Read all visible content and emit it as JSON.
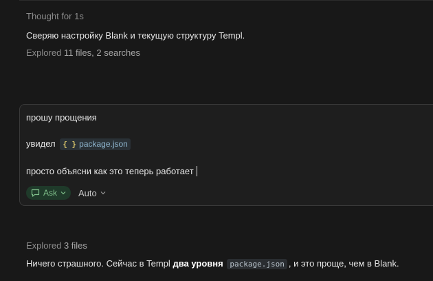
{
  "thought": {
    "text": "Thought for 1s"
  },
  "intro": {
    "text": "Сверяю настройку Blank и текущую структуру Templ."
  },
  "explored_top": {
    "label": "Explored",
    "detail": "11 files, 2 searches"
  },
  "composer": {
    "line1": "прошу прощения",
    "line2_prefix": "увидел",
    "file_chip": {
      "icon": "braces-icon",
      "name": "package.json"
    },
    "line3": "просто объясни как это теперь работает",
    "mode_button": {
      "icon": "chat-icon",
      "label": "Ask"
    },
    "model_button": {
      "label": "Auto"
    }
  },
  "explored_bottom": {
    "label": "Explored",
    "detail": "3 files"
  },
  "answer": {
    "part1": "Ничего страшного. Сейчас в Templ",
    "bold": "два уровня",
    "code": "package.json",
    "part2": ", и это проще, чем в Blank."
  },
  "colors": {
    "background": "#181818",
    "composer_bg": "#1e1e1e",
    "ask_pill_bg": "#1f3a2a",
    "ask_pill_text": "#7fbf8a",
    "file_chip_text": "#8fb6cf"
  }
}
